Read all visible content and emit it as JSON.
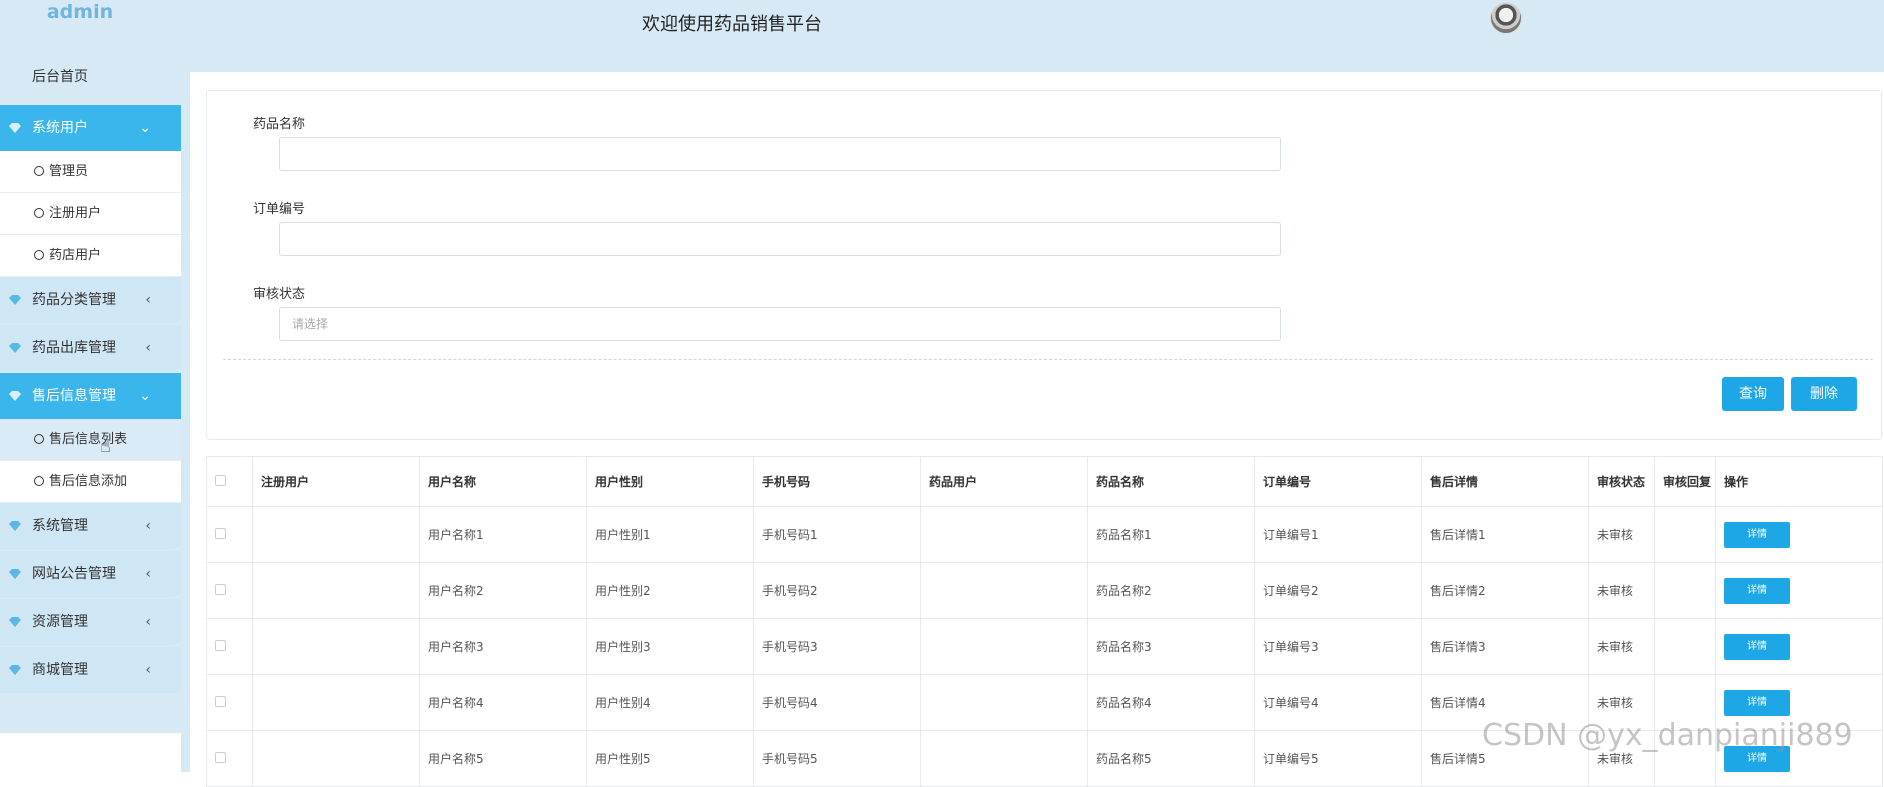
{
  "header": {
    "brand": "admin",
    "site_title": "欢迎使用药品销售平台"
  },
  "sidebar": {
    "home": "后台首页",
    "groups": [
      {
        "label": "系统用户",
        "subs": [
          "管理员",
          "注册用户",
          "药店用户"
        ]
      },
      {
        "label": "药品分类管理"
      },
      {
        "label": "药品出库管理"
      },
      {
        "label": "售后信息管理",
        "subs": [
          "售后信息列表",
          "售后信息添加"
        ]
      },
      {
        "label": "系统管理"
      },
      {
        "label": "网站公告管理"
      },
      {
        "label": "资源管理"
      },
      {
        "label": "商城管理"
      }
    ]
  },
  "search": {
    "drug_name_label": "药品名称",
    "order_no_label": "订单编号",
    "audit_status_label": "审核状态",
    "audit_status_placeholder": "请选择",
    "query_button": "查询",
    "delete_button": "删除"
  },
  "table": {
    "columns": [
      "注册用户",
      "用户名称",
      "用户性别",
      "手机号码",
      "药品用户",
      "药品名称",
      "订单编号",
      "售后详情",
      "审核状态",
      "审核回复",
      "操作"
    ],
    "rows": [
      [
        "",
        "用户名称1",
        "用户性别1",
        "手机号码1",
        "",
        "药品名称1",
        "订单编号1",
        "售后详情1",
        "未审核",
        "",
        "详情"
      ],
      [
        "",
        "用户名称2",
        "用户性别2",
        "手机号码2",
        "",
        "药品名称2",
        "订单编号2",
        "售后详情2",
        "未审核",
        "",
        "详情"
      ],
      [
        "",
        "用户名称3",
        "用户性别3",
        "手机号码3",
        "",
        "药品名称3",
        "订单编号3",
        "售后详情3",
        "未审核",
        "",
        "详情"
      ],
      [
        "",
        "用户名称4",
        "用户性别4",
        "手机号码4",
        "",
        "药品名称4",
        "订单编号4",
        "售后详情4",
        "未审核",
        "",
        "详情"
      ],
      [
        "",
        "用户名称5",
        "用户性别5",
        "手机号码5",
        "",
        "药品名称5",
        "订单编号5",
        "售后详情5",
        "未审核",
        "",
        "详情"
      ]
    ]
  },
  "watermark": "CSDN @yx_danpianji889",
  "colors": {
    "accent": "#1ea7e6",
    "sidebar_bg": "#d6e9f5",
    "active_group": "#3bb6ec"
  }
}
